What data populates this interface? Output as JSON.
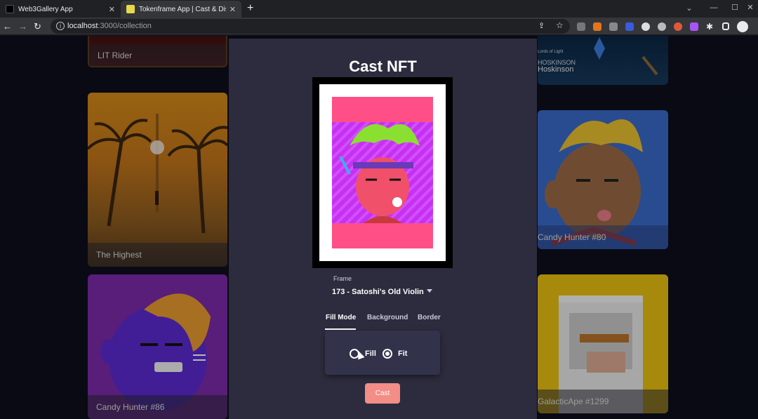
{
  "browser": {
    "tabs": [
      {
        "title": "Web3Gallery App",
        "favicon_color": "#000000"
      },
      {
        "title": "Tokenframe App | Cast & Display",
        "favicon_color": "#e8d84a"
      }
    ],
    "url_host": "localhost",
    "url_path": ":3000/collection"
  },
  "gallery": {
    "cards": [
      {
        "name": "LIT Rider"
      },
      {
        "name": "The Highest"
      },
      {
        "name": "Candy Hunter #86"
      },
      {
        "name": "Hoskinson"
      },
      {
        "name": "Candy Hunter #80"
      },
      {
        "name": "GalacticApe #1299"
      }
    ],
    "hoskinson_banner_small": "Lords of Light",
    "hoskinson_banner_title": "HOSKINSON"
  },
  "modal": {
    "title": "Cast NFT",
    "frame_label": "Frame",
    "frame_value": "173 - Satoshi's Old Violin",
    "tabs": [
      "Fill Mode",
      "Background",
      "Border"
    ],
    "active_tab": "Fill Mode",
    "fill_options": [
      "Fill",
      "Fit"
    ],
    "selected_fill": "Fit",
    "cast_label": "Cast"
  },
  "colors": {
    "modal_bg": "#2c2c3e",
    "cast_button": "#f38d86",
    "art_bg": "#ff4f86",
    "art_stripe": "#d030f0"
  }
}
